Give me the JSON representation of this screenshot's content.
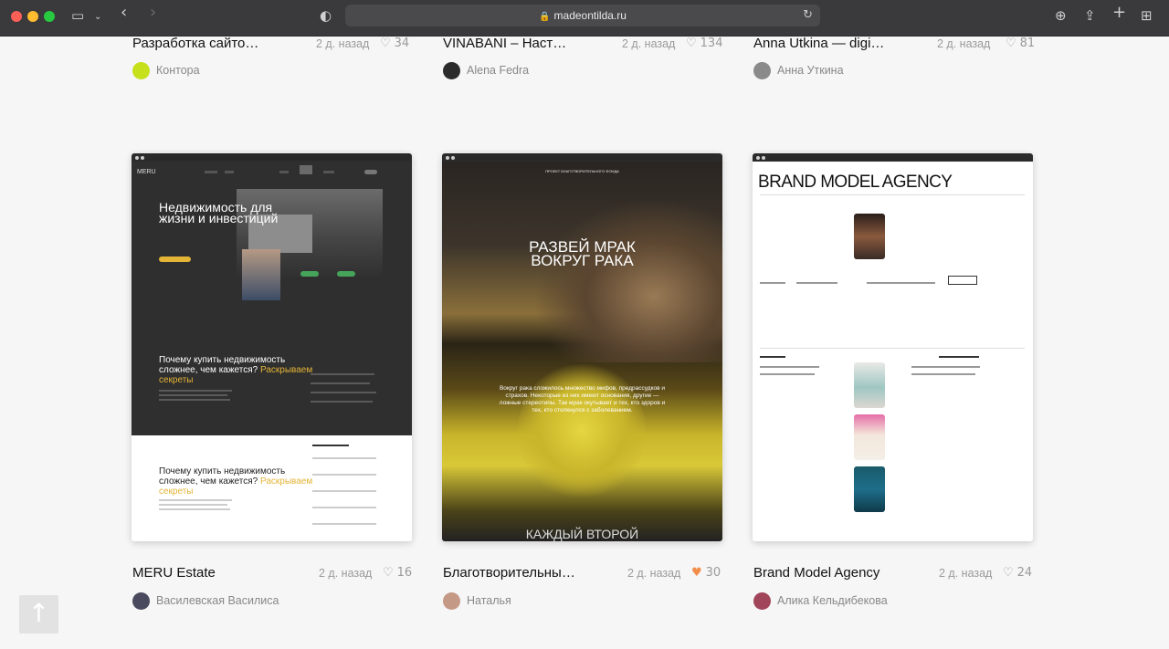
{
  "browser": {
    "url": "madeontilda.ru",
    "icons": {
      "sidebar": "sidebar-icon",
      "back": "chevron-left-icon",
      "forward": "chevron-right-icon",
      "shield": "shield-icon",
      "lock": "lock-icon",
      "reload": "reload-icon",
      "download": "download-icon",
      "share": "share-icon",
      "new_tab": "plus-icon",
      "tabs": "tab-overview-icon"
    }
  },
  "cards_top": [
    {
      "title": "Разработка сайто…",
      "date": "2 д. назад",
      "likes": "34",
      "author": "Контора",
      "avatar_color": "#c6e01c"
    },
    {
      "title": "VINABANI – Наст…",
      "date": "2 д. назад",
      "likes": "134",
      "author": "Alena Fedra",
      "avatar_color": "#2b2b2b"
    },
    {
      "title": "Anna Utkina — digi…",
      "date": "2 д. назад",
      "likes": "81",
      "author": "Анна Уткина",
      "avatar_color": "#8a8a8a"
    }
  ],
  "cards": [
    {
      "title": "MERU Estate",
      "date": "2 д. назад",
      "likes": "16",
      "liked": false,
      "author": "Василевская Василиса",
      "avatar_color": "#4a4a5e",
      "preview": {
        "logo": "MERU",
        "headline": "Недвижимость для жизни и инвестиций",
        "subhead_a": "Почему купить недвижимость сложнее, чем кажется?",
        "subhead_b": "Раскрываем секреты"
      }
    },
    {
      "title": "Благотворительны…",
      "date": "2 д. назад",
      "likes": "30",
      "liked": true,
      "author": "Наталья",
      "avatar_color": "#c49a86",
      "preview": {
        "project": "ПРОЕКТ БЛАГОТВОРИТЕЛЬНОГО ФОНДА",
        "headline_a": "РАЗВЕЙ МРАК",
        "headline_b": "ВОКРУГ РАКА",
        "body": "Вокруг рака сложилось множество мифов, предрассудков и страхов. Некоторые из них имеют основания, другие — ложные стереотипы. Так мрак окутывает и тех, кто здоров и тех, кто столкнулся с заболеванием.",
        "bottom": "КАЖДЫЙ ВТОРОЙ"
      }
    },
    {
      "title": "Brand Model Agency",
      "date": "2 д. назад",
      "likes": "24",
      "liked": false,
      "author": "Алика Кельдибекова",
      "avatar_color": "#a0455a",
      "preview": {
        "headline": "BRAND MODEL AGENCY"
      }
    }
  ],
  "scroll_top": {
    "icon": "arrow-up-icon"
  }
}
